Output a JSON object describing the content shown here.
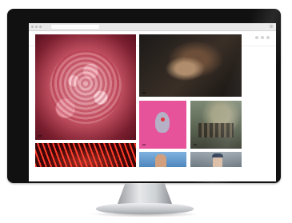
{
  "browser": {
    "icons": [
      "window-controls-icon",
      "menu-icon"
    ]
  },
  "site": {
    "logo_left": "",
    "logo_accent": "",
    "nav": [
      "",
      "",
      "",
      ""
    ],
    "header_icons": [
      "search-icon",
      "user-icon",
      "menu-icon"
    ]
  },
  "tiles": [
    {
      "name": "featured-berry",
      "tag": "",
      "caption": ""
    },
    {
      "name": "dark-figure",
      "tag": "",
      "caption": ""
    },
    {
      "name": "pink-art",
      "tag": "",
      "caption": ""
    },
    {
      "name": "painting",
      "tag": "",
      "caption": ""
    },
    {
      "name": "red-lights",
      "tag": "",
      "caption": ""
    },
    {
      "name": "people-photo",
      "tag": "",
      "caption": ""
    },
    {
      "name": "portrait",
      "tag": "",
      "caption": ""
    }
  ],
  "colors": {
    "accent": "#e33b5a",
    "monitor_bezel": "#111111",
    "pink_tile": "#e6539a"
  }
}
